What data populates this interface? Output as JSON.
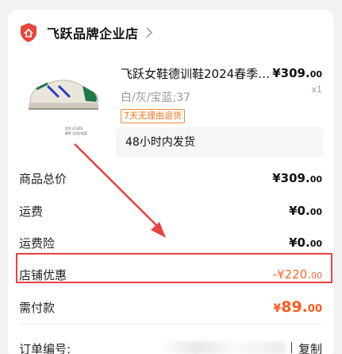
{
  "shop": {
    "name": "飞跃品牌企业店",
    "icon": "shop-logo-icon",
    "chevron": "chevron-right-icon"
  },
  "product": {
    "title": "飞跃女鞋德训鞋2024春季…",
    "price_main": "¥309.",
    "price_dec": "00",
    "spec": "白/灰/宝蓝;37",
    "qty": "x1",
    "badge": "7天无理由退货",
    "shipping": "48小时内发货",
    "thumb_caption": "货号 413ZS\n颜色 白/灰/宝蓝"
  },
  "summary": {
    "total": {
      "label": "商品总价",
      "value_main": "¥309.",
      "value_dec": "00"
    },
    "shipping_fee": {
      "label": "运费",
      "value_main": "¥0.",
      "value_dec": "00"
    },
    "insurance": {
      "label": "运费险",
      "value_main": "¥0.",
      "value_dec": "00"
    },
    "discount": {
      "label": "店铺优惠",
      "value_main": "-¥220.",
      "value_dec": "00"
    },
    "payable": {
      "label": "需付款",
      "value_cur": "¥",
      "value_main": "89.",
      "value_dec": "00"
    }
  },
  "order": {
    "label": "订单编号:",
    "copy": "复制"
  },
  "colors": {
    "accent": "#ff5a1f",
    "annotation": "#e9423f",
    "logo": "#e8453c"
  }
}
